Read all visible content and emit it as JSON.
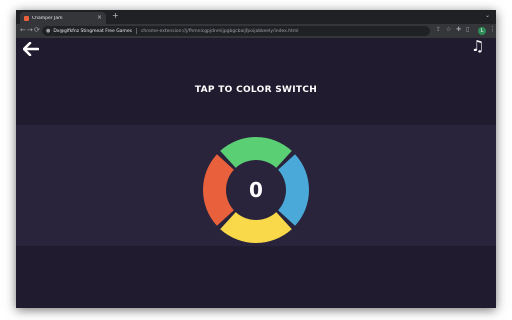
{
  "browser": {
    "tab": {
      "title": "Champer Jam",
      "close_glyph": "×"
    },
    "new_tab_glyph": "+",
    "tab_menu_glyph": "⌄",
    "nav": {
      "back": "←",
      "forward": "→",
      "reload": "⟳"
    },
    "site_name": "Dx@glfkfnz Stingmeat Free Games",
    "url": "chrome-extension://j/fhmnicgpjdnmijpgbgcbaijfpoijabkeely/index.html",
    "icons": [
      "share-icon",
      "star-icon",
      "extensions-icon",
      "sidepanel-icon"
    ],
    "profile_initial": "L",
    "menu_glyph": "⋮"
  },
  "game": {
    "title": "TAP TO COLOR SWITCH",
    "score": "0",
    "music_glyph": "♫",
    "colors": {
      "background": "#201b2e",
      "band": "#29243b",
      "top": "#5bcf73",
      "right": "#4aa9d8",
      "bottom": "#f9d94a",
      "left": "#e8603c",
      "center": "#29243b"
    }
  }
}
